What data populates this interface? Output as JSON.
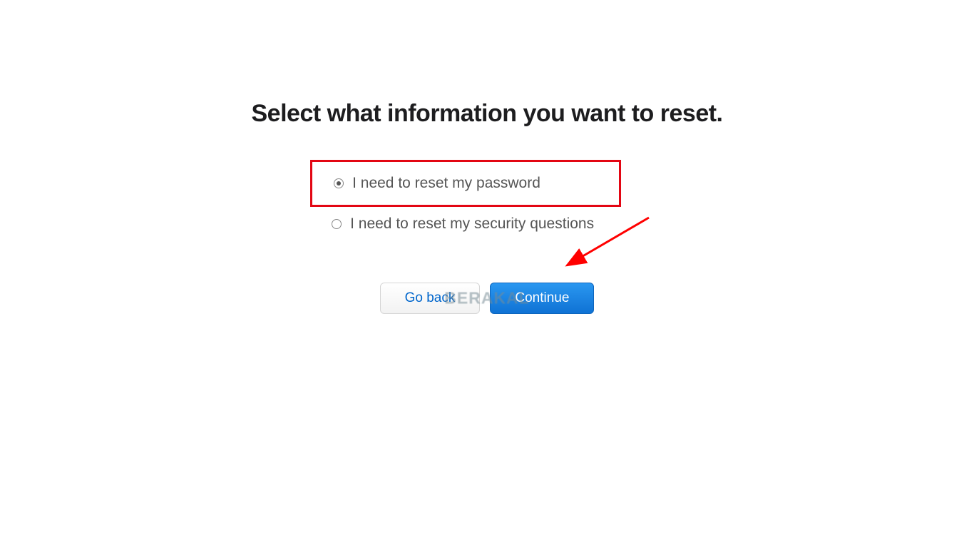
{
  "heading": "Select what information you want to reset.",
  "options": {
    "password": {
      "label": "I need to reset my password",
      "selected": true
    },
    "security_questions": {
      "label": "I need to reset my security questions",
      "selected": false
    }
  },
  "buttons": {
    "back": "Go back",
    "continue": "Continue"
  },
  "watermark": "BERAKAL",
  "annotation": {
    "highlight_color": "#e30613",
    "arrow_color": "#ff0000"
  }
}
